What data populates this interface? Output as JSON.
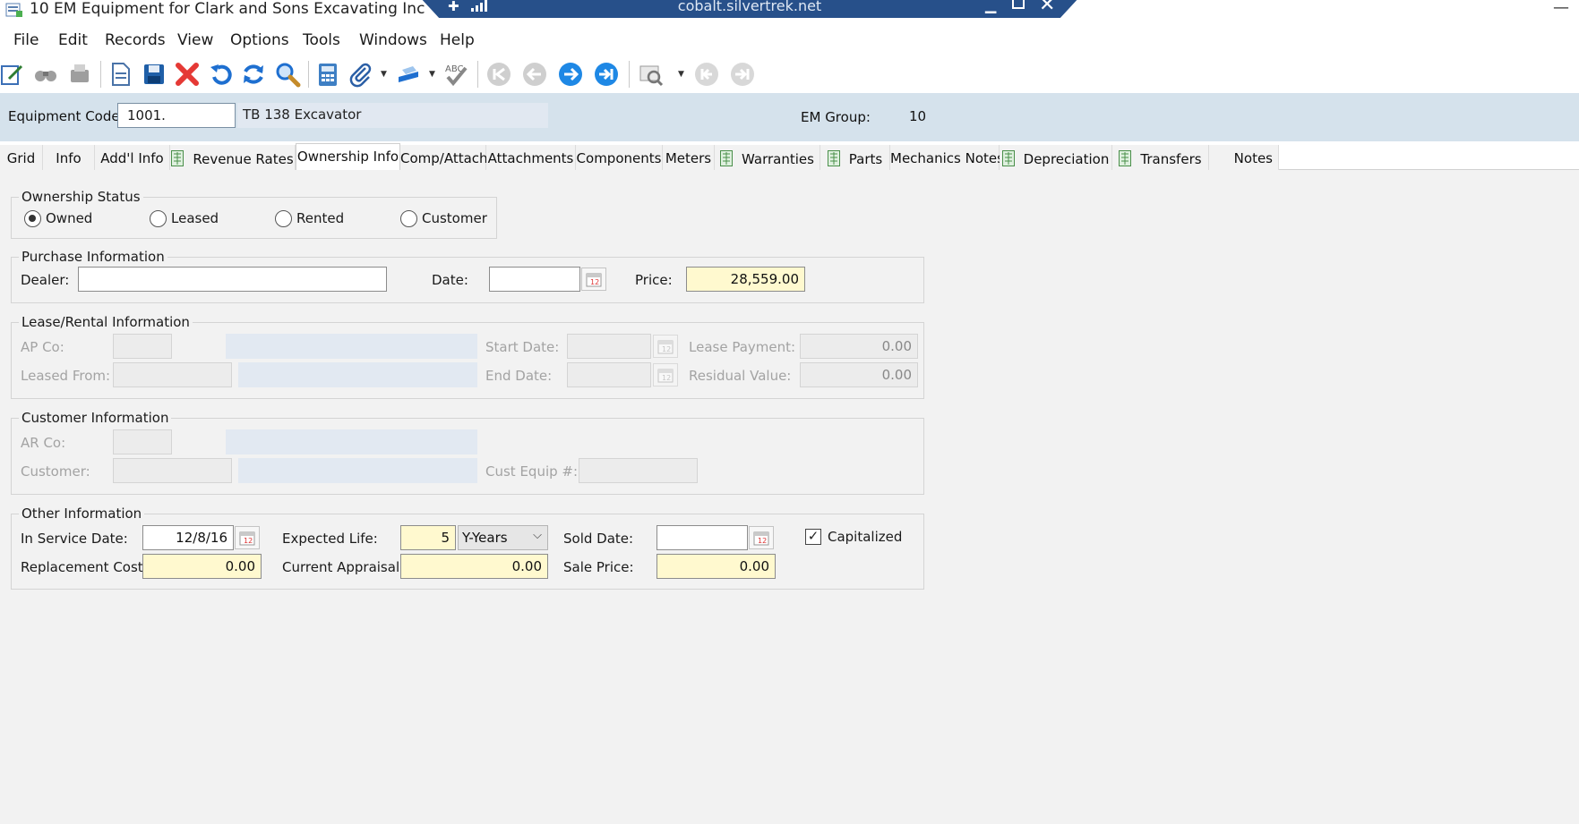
{
  "window": {
    "title": "10 EM Equipment for Clark and Sons Excavating Inc",
    "remote_host": "cobalt.silvertrek.net"
  },
  "menu": [
    "File",
    "Edit",
    "Records",
    "View",
    "Options",
    "Tools",
    "Windows",
    "Help"
  ],
  "header": {
    "equipment_code_label": "Equipment Code:",
    "equipment_code_value": "1001.",
    "equipment_description": "TB 138 Excavator",
    "em_group_label": "EM Group:",
    "em_group_value": "10"
  },
  "tabs": [
    {
      "label": "Grid"
    },
    {
      "label": "Info"
    },
    {
      "label": "Add'l Info"
    },
    {
      "label": "Revenue Rates"
    },
    {
      "label": "Ownership Info"
    },
    {
      "label": "Comp/Attach"
    },
    {
      "label": "Attachments"
    },
    {
      "label": "Components"
    },
    {
      "label": "Meters"
    },
    {
      "label": "Warranties"
    },
    {
      "label": "Parts"
    },
    {
      "label": "Mechanics Notes"
    },
    {
      "label": "Depreciation"
    },
    {
      "label": "Transfers"
    },
    {
      "label": "Notes"
    }
  ],
  "active_tab": "Ownership Info",
  "ownership_status": {
    "title": "Ownership Status",
    "options": [
      "Owned",
      "Leased",
      "Rented",
      "Customer"
    ],
    "selected": "Owned"
  },
  "purchase": {
    "title": "Purchase Information",
    "dealer_label": "Dealer:",
    "dealer_value": "",
    "date_label": "Date:",
    "date_value": "",
    "price_label": "Price:",
    "price_value": "28,559.00"
  },
  "lease": {
    "title": "Lease/Rental Information",
    "ap_co_label": "AP Co:",
    "leased_from_label": "Leased From:",
    "start_date_label": "Start Date:",
    "end_date_label": "End Date:",
    "lease_payment_label": "Lease Payment:",
    "lease_payment_value": "0.00",
    "residual_value_label": "Residual Value:",
    "residual_value_value": "0.00"
  },
  "customer": {
    "title": "Customer Information",
    "ar_co_label": "AR Co:",
    "customer_label": "Customer:",
    "cust_equip_label": "Cust Equip #:"
  },
  "other": {
    "title": "Other Information",
    "in_service_label": "In Service Date:",
    "in_service_value": "12/8/16",
    "expected_life_label": "Expected Life:",
    "expected_life_value": "5",
    "expected_life_unit": "Y-Years",
    "sold_date_label": "Sold Date:",
    "sold_date_value": "",
    "capitalized_label": "Capitalized",
    "capitalized_checked": true,
    "replacement_cost_label": "Replacement Cost:",
    "replacement_cost_value": "0.00",
    "current_appraisal_label": "Current Appraisal:",
    "current_appraisal_value": "0.00",
    "sale_price_label": "Sale Price:",
    "sale_price_value": "0.00"
  },
  "colors": {
    "header_strip": "#d5e2ec",
    "required_field": "#fff9cf",
    "rdp_bar": "#27508a",
    "nav_button": "#1e88e5"
  }
}
